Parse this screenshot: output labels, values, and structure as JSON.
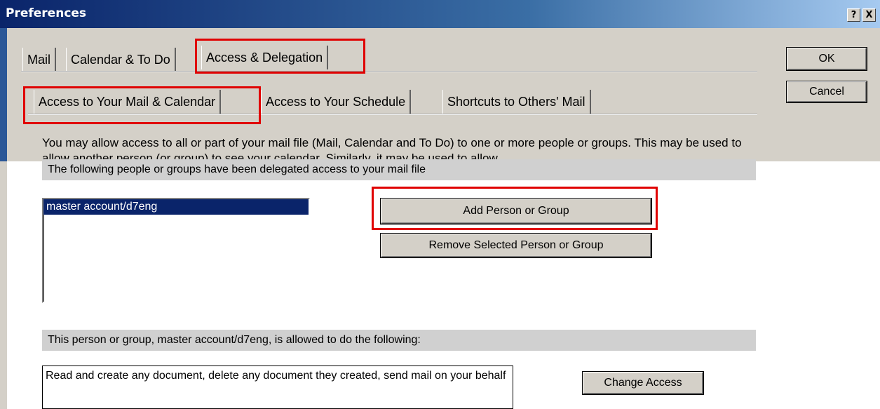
{
  "window": {
    "title": "Preferences",
    "help_glyph": "?",
    "close_glyph": "X"
  },
  "buttons": {
    "ok": "OK",
    "cancel": "Cancel",
    "add": "Add Person or Group",
    "remove": "Remove Selected Person or Group",
    "change": "Change Access"
  },
  "tabs_top": [
    "Mail",
    "Calendar & To Do",
    "Access & Delegation"
  ],
  "tabs_sub": [
    "Access to Your Mail & Calendar",
    "Access to Your Schedule",
    "Shortcuts to Others' Mail"
  ],
  "description": "You may allow access to all or part of your mail file (Mail, Calendar and To Do) to one or more people or groups. This may be used to allow another person (or group) to see your calendar. Similarly, it may be used to allow",
  "delegated_header": "The following people or groups have been delegated access to your mail file",
  "delegates": [
    "master account/d7eng"
  ],
  "allowed_header": "This person or group, master account/d7eng, is allowed to do the following:",
  "access_text": "Read and create any document, delete any document they created, send mail on your behalf",
  "highlight_color": "#e00000"
}
